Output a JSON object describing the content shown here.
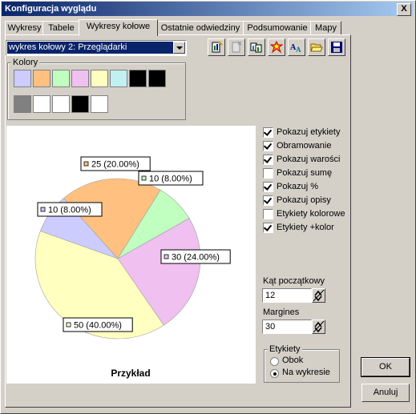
{
  "window": {
    "title": "Konfiguracja wyglądu",
    "close_label": "X"
  },
  "tabs": [
    {
      "label": "Wykresy",
      "active": false
    },
    {
      "label": "Tabele",
      "active": false
    },
    {
      "label": "Wykresy kołowe",
      "active": true
    },
    {
      "label": "Ostatnie odwiedziny",
      "active": false
    },
    {
      "label": "Podsumowanie",
      "active": false
    },
    {
      "label": "Mapy",
      "active": false
    }
  ],
  "chart_selector": {
    "value": "wykres kołowy 2: Przeglądarki"
  },
  "toolbar_icons": [
    "new-chart-icon",
    "delete-chart-icon",
    "copy-chart-icon",
    "effects-icon",
    "font-icon",
    "open-folder-icon",
    "save-icon"
  ],
  "colors_group": {
    "label": "Kolory",
    "row1": [
      "#ccccff",
      "#ffc080",
      "#c0ffc0",
      "#f0c0f0",
      "#ffffc0",
      "#c0f0f0",
      "#000000",
      "#000000"
    ],
    "row2": [
      "#808080",
      "#ffffff",
      "#ffffff",
      "#000000",
      "#ffffff"
    ]
  },
  "chart_data": {
    "type": "pie",
    "title": "Przykład",
    "start_angle_deg": 12,
    "slices": [
      {
        "value": 25,
        "label": "25 (20.00%)",
        "color": "#ffc080"
      },
      {
        "value": 10,
        "label": "10 (8.00%)",
        "color": "#c0ffc0"
      },
      {
        "value": 30,
        "label": "30 (24.00%)",
        "color": "#f0c0f0"
      },
      {
        "value": 50,
        "label": "50 (40.00%)",
        "color": "#ffffc0"
      },
      {
        "value": 10,
        "label": "10 (8.00%)",
        "color": "#ccccff"
      }
    ]
  },
  "options": [
    {
      "label": "Pokazuj etykiety",
      "checked": true
    },
    {
      "label": "Obramowanie",
      "checked": true
    },
    {
      "label": "Pokazuj warości",
      "checked": true
    },
    {
      "label": "Pokazuj sumę",
      "checked": false
    },
    {
      "label": "Pokazuj %",
      "checked": true
    },
    {
      "label": "Pokazuj opisy",
      "checked": true
    },
    {
      "label": "Etykiety kolorowe",
      "checked": false
    },
    {
      "label": "Etykiety +kolor",
      "checked": true
    }
  ],
  "start_angle": {
    "label": "Kąt początkowy",
    "value": "12"
  },
  "margins": {
    "label": "Margines",
    "value": "30"
  },
  "labels_group": {
    "label": "Etykiety",
    "options": [
      {
        "label": "Obok",
        "selected": false
      },
      {
        "label": "Na wykresie",
        "selected": true
      }
    ]
  },
  "buttons": {
    "ok": "OK",
    "cancel": "Anuluj"
  }
}
